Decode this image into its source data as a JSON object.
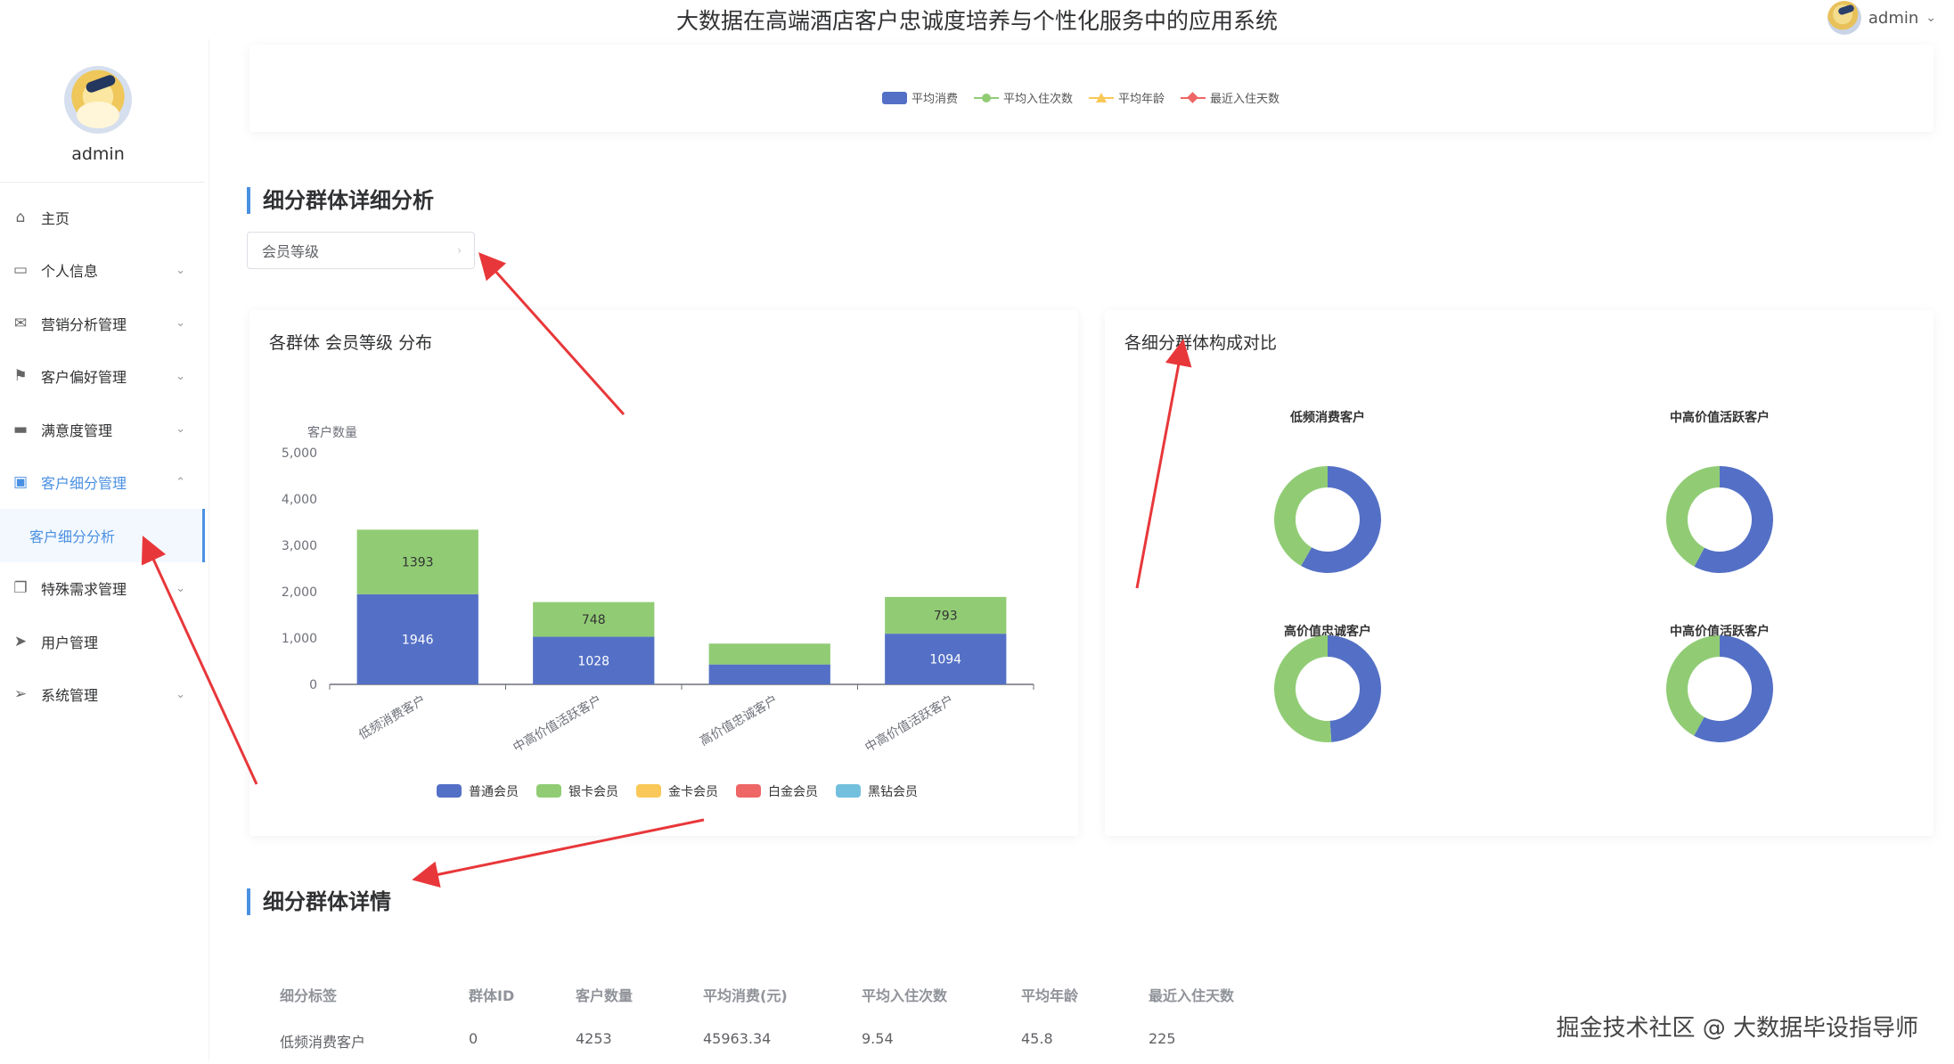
{
  "header": {
    "title": "大数据在高端酒店客户忠诚度培养与个性化服务中的应用系统",
    "user_name": "admin"
  },
  "sidebar": {
    "profile_name": "admin",
    "items": [
      {
        "label": "主页",
        "icon": "home-icon",
        "glyph": "⌂"
      },
      {
        "label": "个人信息",
        "icon": "id-card-icon",
        "glyph": "▭"
      },
      {
        "label": "营销分析管理",
        "icon": "mail-icon",
        "glyph": "✉"
      },
      {
        "label": "客户偏好管理",
        "icon": "flag-icon",
        "glyph": "⚑"
      },
      {
        "label": "满意度管理",
        "icon": "wallet-icon",
        "glyph": "▬"
      },
      {
        "label": "客户细分管理",
        "icon": "clipboard-icon",
        "glyph": "▣"
      },
      {
        "label": "特殊需求管理",
        "icon": "copy-icon",
        "glyph": "❐"
      },
      {
        "label": "用户管理",
        "icon": "send-icon",
        "glyph": "➤"
      },
      {
        "label": "系统管理",
        "icon": "navigation-icon",
        "glyph": "➢"
      }
    ],
    "subitem": {
      "label": "客户细分分析"
    }
  },
  "top_legend": [
    "平均消费",
    "平均入住次数",
    "平均年龄",
    "最近入住天数"
  ],
  "colors": {
    "accent": "#4a90e2",
    "blue": "#5470c6",
    "green": "#91cc75",
    "yellow": "#fac858",
    "red": "#ee6666",
    "lightblue": "#73c0de",
    "arrow": "#e8373a"
  },
  "section_detail": {
    "title": "细分群体详细分析",
    "select_value": "会员等级"
  },
  "bar_card": {
    "title": "各群体 会员等级 分布"
  },
  "donut_card": {
    "title": "各细分群体构成对比"
  },
  "section_table": {
    "title": "细分群体详情"
  },
  "table": {
    "headers": [
      "细分标签",
      "群体ID",
      "客户数量",
      "平均消费(元)",
      "平均入住次数",
      "平均年龄",
      "最近入住天数"
    ],
    "rows": [
      [
        "低频消费客户",
        "0",
        "4253",
        "45963.34",
        "9.54",
        "45.8",
        "225"
      ]
    ]
  },
  "watermark": "掘金技术社区 @ 大数据毕设指导师",
  "chart_data": [
    {
      "type": "bar",
      "title": "各群体 会员等级 分布",
      "ylabel": "客户数量",
      "ylim": [
        0,
        5000
      ],
      "yticks": [
        "0",
        "1,000",
        "2,000",
        "3,000",
        "4,000",
        "5,000"
      ],
      "categories": [
        "低频消费客户",
        "中高价值活跃客户",
        "高价值忠诚客户",
        "中高价值活跃客户"
      ],
      "stacked": true,
      "series": [
        {
          "name": "普通会员",
          "values": [
            1946,
            1028,
            430,
            1094
          ],
          "labels": [
            "1946",
            "1028",
            "",
            "1094"
          ]
        },
        {
          "name": "银卡会员",
          "values": [
            1393,
            748,
            450,
            793
          ],
          "labels": [
            "1393",
            "748",
            "",
            "793"
          ]
        },
        {
          "name": "金卡会员",
          "values": [
            0,
            0,
            0,
            0
          ],
          "labels": [
            "",
            "",
            "",
            ""
          ]
        },
        {
          "name": "白金会员",
          "values": [
            0,
            0,
            0,
            0
          ],
          "labels": [
            "",
            "",
            "",
            ""
          ]
        },
        {
          "name": "黑钻会员",
          "values": [
            0,
            0,
            0,
            0
          ],
          "labels": [
            "",
            "",
            "",
            ""
          ]
        }
      ],
      "legend": "bottom"
    },
    {
      "type": "pie",
      "title": "各细分群体构成对比",
      "donuts": [
        {
          "title": "低频消费客户",
          "slices": [
            {
              "name": "普通会员",
              "value": 1946
            },
            {
              "name": "银卡会员",
              "value": 1393
            }
          ]
        },
        {
          "title": "中高价值活跃客户",
          "slices": [
            {
              "name": "普通会员",
              "value": 1028
            },
            {
              "name": "银卡会员",
              "value": 748
            }
          ]
        },
        {
          "title": "高价值忠诚客户",
          "slices": [
            {
              "name": "普通会员",
              "value": 430
            },
            {
              "name": "银卡会员",
              "value": 450
            }
          ]
        },
        {
          "title": "中高价值活跃客户",
          "slices": [
            {
              "name": "普通会员",
              "value": 1094
            },
            {
              "name": "银卡会员",
              "value": 793
            }
          ]
        }
      ]
    }
  ]
}
